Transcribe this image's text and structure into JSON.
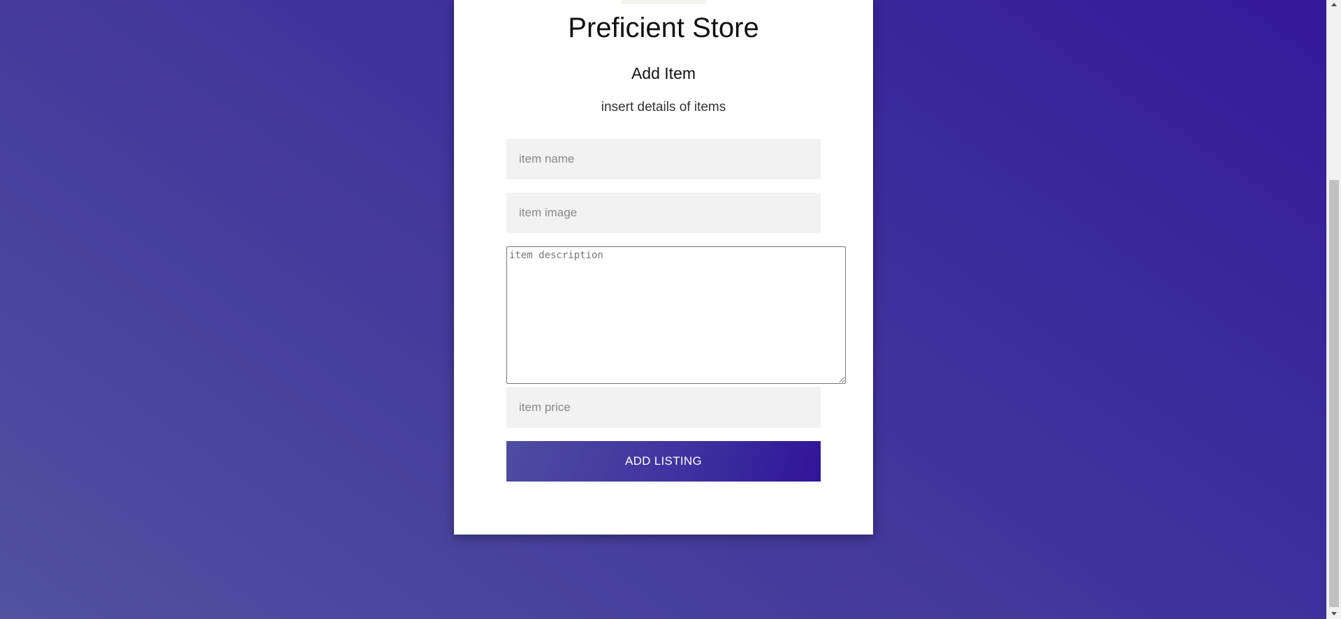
{
  "store": {
    "title": "Preficient Store"
  },
  "form": {
    "heading": "Add Item",
    "subheading": "insert details of items",
    "item_name_placeholder": "item name",
    "item_image_placeholder": "item image",
    "item_description_placeholder": "item description",
    "item_price_placeholder": "item price",
    "submit_label": "ADD LISTING"
  },
  "colors": {
    "background_start": "#5152a0",
    "background_end": "#331a99",
    "card": "#ffffff",
    "field_background": "#f2f2f2",
    "button_start": "#4f4ca0",
    "button_end": "#2f1498"
  },
  "scrollbar": {
    "up_icon": "scroll-up-arrow",
    "down_icon": "scroll-down-arrow"
  }
}
